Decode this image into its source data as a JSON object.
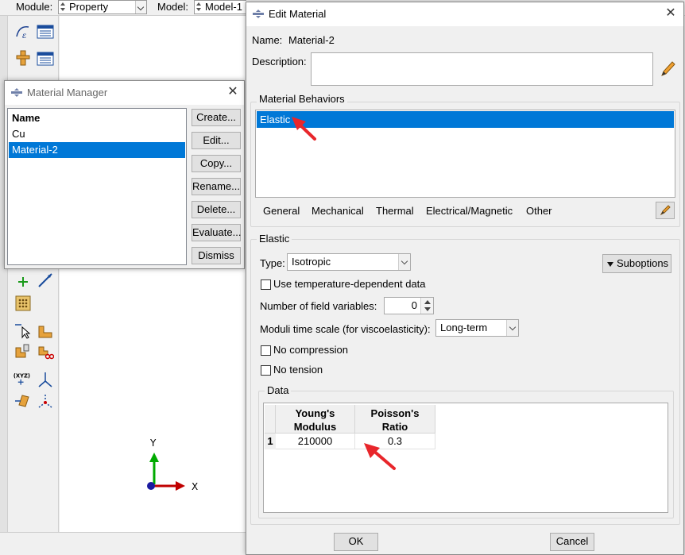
{
  "main_window": {
    "module_label": "Module:",
    "module_value": "Property",
    "model_label": "Model:",
    "model_value": "Model-1",
    "axis_y": "Y",
    "axis_x": "X",
    "axis_y_color": "#00aa00",
    "axis_x_color": "#c00000",
    "toolbox": {
      "xyz_tag": "(XYZ)"
    }
  },
  "material_manager": {
    "title": "Material Manager",
    "list_header": "Name",
    "materials": [
      "Cu",
      "Material-2"
    ],
    "selected_index": 1,
    "buttons": {
      "create": "Create...",
      "edit": "Edit...",
      "copy": "Copy...",
      "rename": "Rename...",
      "delete": "Delete...",
      "evaluate": "Evaluate...",
      "dismiss": "Dismiss"
    }
  },
  "edit_material": {
    "title": "Edit Material",
    "name_label": "Name:",
    "name_value": "Material-2",
    "description_label": "Description:",
    "description_value": "",
    "behaviors_label": "Material Behaviors",
    "behaviors": [
      "Elastic"
    ],
    "menus": {
      "general": "General",
      "mechanical": "Mechanical",
      "thermal": "Thermal",
      "electrical": "Electrical/Magnetic",
      "other": "Other"
    },
    "elastic": {
      "section_label": "Elastic",
      "type_label": "Type:",
      "type_value": "Isotropic",
      "suboptions_label": "Suboptions",
      "temp_dependent_label": "Use temperature-dependent data",
      "temp_dependent_checked": false,
      "field_vars_label": "Number of field variables:",
      "field_vars_value": "0",
      "moduli_label": "Moduli time scale (for viscoelasticity):",
      "moduli_value": "Long-term",
      "no_compression_label": "No compression",
      "no_compression_checked": false,
      "no_tension_label": "No tension",
      "no_tension_checked": false
    },
    "data": {
      "group_label": "Data",
      "columns": [
        {
          "line1": "Young's",
          "line2": "Modulus"
        },
        {
          "line1": "Poisson's",
          "line2": "Ratio"
        }
      ],
      "rows": [
        {
          "index": "1",
          "values": [
            "210000",
            "0.3"
          ]
        }
      ]
    },
    "ok_label": "OK",
    "cancel_label": "Cancel"
  },
  "colors": {
    "selection": "#0078d7",
    "annotation_arrow": "#e8262b"
  }
}
